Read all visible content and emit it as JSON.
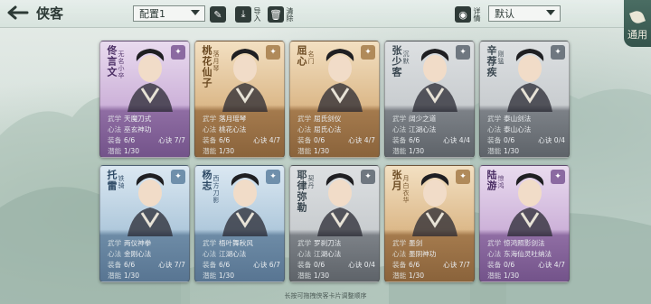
{
  "header": {
    "title": "侠客",
    "config_select": "配置1",
    "tools": [
      {
        "name": "rename",
        "label": ""
      },
      {
        "name": "import",
        "label": "导入"
      },
      {
        "name": "clear",
        "label": "清除"
      }
    ],
    "detail_label": "详情",
    "sort_select": "默认",
    "side_tab_label": "通用"
  },
  "cards": [
    {
      "name": "佟言文",
      "title": "无名小卒",
      "frame": "purple",
      "wuxue": "天魔刀式",
      "xinfa": "巫玄神功",
      "juezhu": "7/7",
      "zhuangbei": "6/6",
      "qianneng": "1/30"
    },
    {
      "name": "桃花仙子",
      "title": "落月琴",
      "frame": "gold",
      "wuxue": "落月瑶琴",
      "xinfa": "桃花心法",
      "juezhu": "4/7",
      "zhuangbei": "6/6",
      "qianneng": "1/30"
    },
    {
      "name": "屈心",
      "title": "名门",
      "frame": "gold",
      "wuxue": "屈氏剑仪",
      "xinfa": "屈氏心法",
      "juezhu": "4/7",
      "zhuangbei": "0/6",
      "qianneng": "1/30"
    },
    {
      "name": "张少客",
      "title": "沉默",
      "frame": "gray",
      "wuxue": "阔少之道",
      "xinfa": "江湖心法",
      "juezhu": "4/4",
      "zhuangbei": "6/6",
      "qianneng": "1/30"
    },
    {
      "name": "辛荐疾",
      "title": "刚猛",
      "frame": "gray",
      "wuxue": "泰山剑法",
      "xinfa": "泰山心法",
      "juezhu": "0/4",
      "zhuangbei": "0/6",
      "qianneng": "1/30"
    },
    {
      "name": "托雷",
      "title": "铁骑",
      "frame": "blue",
      "wuxue": "两仪神拳",
      "xinfa": "金刚心法",
      "juezhu": "7/7",
      "zhuangbei": "6/6",
      "qianneng": "1/30"
    },
    {
      "name": "杨志",
      "title": "西方刀影",
      "frame": "blue",
      "wuxue": "梧叶舞秋风",
      "xinfa": "江湖心法",
      "juezhu": "6/7",
      "zhuangbei": "6/6",
      "qianneng": "1/30"
    },
    {
      "name": "耶律弥勒",
      "title": "契丹",
      "frame": "gray",
      "wuxue": "罗刹刀法",
      "xinfa": "江湖心法",
      "juezhu": "0/4",
      "zhuangbei": "0/6",
      "qianneng": "1/30"
    },
    {
      "name": "张月",
      "title": "月白衣华",
      "frame": "gold",
      "wuxue": "墨剑",
      "xinfa": "墨阴神功",
      "juezhu": "7/7",
      "zhuangbei": "6/6",
      "qianneng": "1/30"
    },
    {
      "name": "陆游",
      "title": "惊鸿",
      "frame": "purple",
      "wuxue": "惊鸿照影剑法",
      "xinfa": "东海仙灵吐纳法",
      "juezhu": "4/7",
      "zhuangbei": "0/6",
      "qianneng": "1/30"
    }
  ],
  "stat_labels": {
    "wuxue": "武学",
    "xinfa": "心法",
    "juezhu": "心诀",
    "zhuangbei": "装备",
    "qianneng": "潜能"
  },
  "footer_hint": "长按可拖拽侠客卡片调整顺序"
}
